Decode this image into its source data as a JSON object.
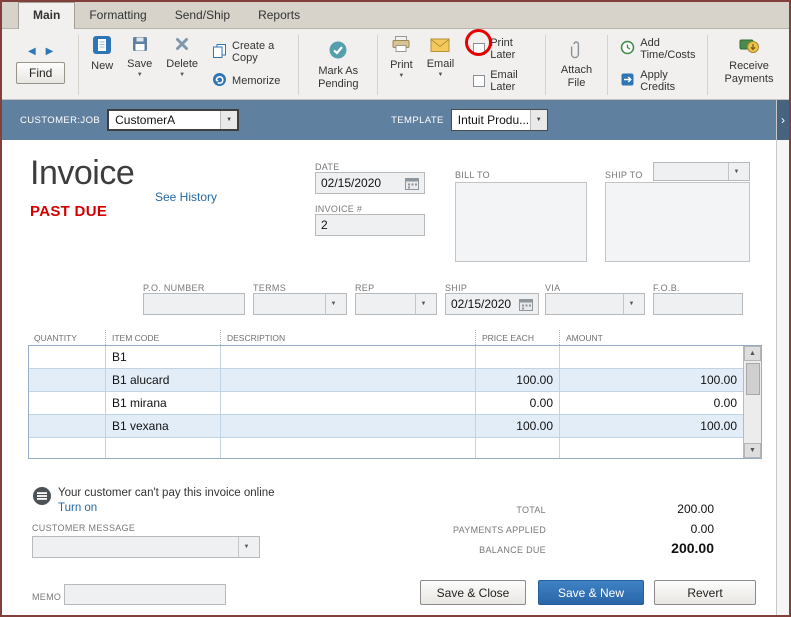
{
  "tabs": [
    {
      "label": "Main"
    },
    {
      "label": "Formatting"
    },
    {
      "label": "Send/Ship"
    },
    {
      "label": "Reports"
    }
  ],
  "toolbar": {
    "find": "Find",
    "new": "New",
    "save": "Save",
    "delete": "Delete",
    "create_copy": "Create a Copy",
    "memorize": "Memorize",
    "mark_pending": "Mark As Pending",
    "print": "Print",
    "email": "Email",
    "print_later": "Print Later",
    "email_later": "Email Later",
    "attach_file": "Attach File",
    "add_time_costs": "Add Time/Costs",
    "apply_credits": "Apply Credits",
    "receive_payments": "Receive Payments"
  },
  "customer_bar": {
    "customer_job_label": "CUSTOMER:JOB",
    "customer_job_value": "CustomerA",
    "template_label": "TEMPLATE",
    "template_value": "Intuit Produ..."
  },
  "invoice": {
    "title": "Invoice",
    "see_history": "See History",
    "status": "PAST DUE",
    "date_label": "DATE",
    "date": "02/15/2020",
    "number_label": "INVOICE #",
    "number": "2",
    "bill_to_label": "BILL TO",
    "ship_to_label": "SHIP TO"
  },
  "order_fields": {
    "po_label": "P.O. NUMBER",
    "terms_label": "TERMS",
    "rep_label": "REP",
    "ship_label": "SHIP",
    "ship_date": "02/15/2020",
    "via_label": "VIA",
    "fob_label": "F.O.B."
  },
  "items": {
    "columns": [
      "QUANTITY",
      "ITEM CODE",
      "DESCRIPTION",
      "PRICE EACH",
      "AMOUNT"
    ],
    "rows": [
      {
        "quantity": "",
        "item_code": "B1",
        "description": "",
        "price_each": "",
        "amount": ""
      },
      {
        "quantity": "",
        "item_code": "B1 alucard",
        "description": "",
        "price_each": "100.00",
        "amount": "100.00"
      },
      {
        "quantity": "",
        "item_code": "B1 mirana",
        "description": "",
        "price_each": "0.00",
        "amount": "0.00"
      },
      {
        "quantity": "",
        "item_code": "B1 vexana",
        "description": "",
        "price_each": "100.00",
        "amount": "100.00"
      }
    ]
  },
  "payment_notice": {
    "message": "Your customer can't pay this invoice online",
    "action": "Turn on"
  },
  "footer": {
    "customer_message_label": "CUSTOMER MESSAGE",
    "memo_label": "MEMO",
    "total_label": "TOTAL",
    "total": "200.00",
    "payments_applied_label": "PAYMENTS APPLIED",
    "payments_applied": "0.00",
    "balance_due_label": "BALANCE DUE",
    "balance_due": "200.00",
    "save_close": "Save & Close",
    "save_new": "Save & New",
    "revert": "Revert"
  },
  "icons": {
    "back_arrow": "◀",
    "forward_arrow": "▶",
    "dropdown_caret": "▼",
    "scroll_up": "▲",
    "scroll_down": "▼",
    "collapse_chevron": "›"
  },
  "colors": {
    "accent_blue": "#2e76b5",
    "header_blue": "#60809f",
    "past_due_red": "#d40000",
    "annotation_red": "#e60000",
    "row_alt": "#e3edf8"
  }
}
